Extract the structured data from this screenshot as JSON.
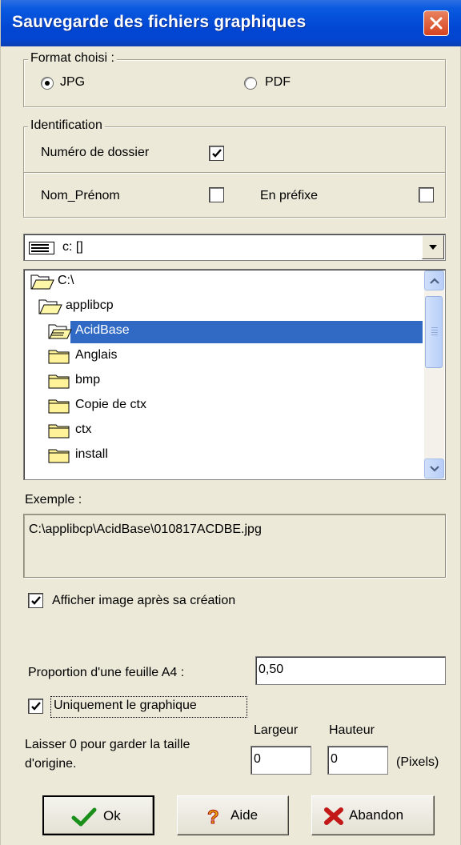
{
  "window": {
    "title": "Sauvegarde des fichiers graphiques",
    "close_icon": "close-icon"
  },
  "format": {
    "legend": "Format choisi :",
    "options": [
      {
        "label": "JPG",
        "selected": true
      },
      {
        "label": "PDF",
        "selected": false
      }
    ]
  },
  "identification": {
    "legend": "Identification",
    "numero_dossier": {
      "label": "Numéro de dossier",
      "checked": true
    },
    "nom_prenom": {
      "label": "Nom_Prénom",
      "checked": false
    },
    "en_prefixe": {
      "label": "En préfixe",
      "checked": false
    }
  },
  "drive": {
    "value": "c: []",
    "icon": "drive-icon"
  },
  "folders": [
    {
      "label": "C:\\",
      "icon": "open-folder-icon",
      "selected": false
    },
    {
      "label": "applibcp",
      "icon": "open-folder-icon",
      "selected": false
    },
    {
      "label": "AcidBase",
      "icon": "open-folder-icon",
      "selected": true
    },
    {
      "label": "Anglais",
      "icon": "folder-icon",
      "selected": false
    },
    {
      "label": "bmp",
      "icon": "folder-icon",
      "selected": false
    },
    {
      "label": "Copie de ctx",
      "icon": "folder-icon",
      "selected": false
    },
    {
      "label": "ctx",
      "icon": "folder-icon",
      "selected": false
    },
    {
      "label": "install",
      "icon": "folder-icon",
      "selected": false
    }
  ],
  "example": {
    "label": "Exemple :",
    "value": "C:\\applibcp\\AcidBase\\010817ACDBE.jpg"
  },
  "afficher_image": {
    "label": "Afficher image après sa création",
    "checked": true
  },
  "proportion": {
    "label": "Proportion d'une feuille A4 :",
    "value": "0,50"
  },
  "uniquement": {
    "label": "Uniquement le graphique",
    "checked": true
  },
  "size": {
    "hint_line1": "Laisser 0 pour garder la taille",
    "hint_line2": "d'origine.",
    "largeur_label": "Largeur",
    "hauteur_label": "Hauteur",
    "largeur_value": "0",
    "hauteur_value": "0",
    "unit": "(Pixels)"
  },
  "buttons": {
    "ok": "Ok",
    "aide": "Aide",
    "abandon": "Abandon"
  },
  "colors": {
    "titlebar": "#0047d4",
    "selection": "#316ac5",
    "dialog_bg": "#ece9d8"
  }
}
